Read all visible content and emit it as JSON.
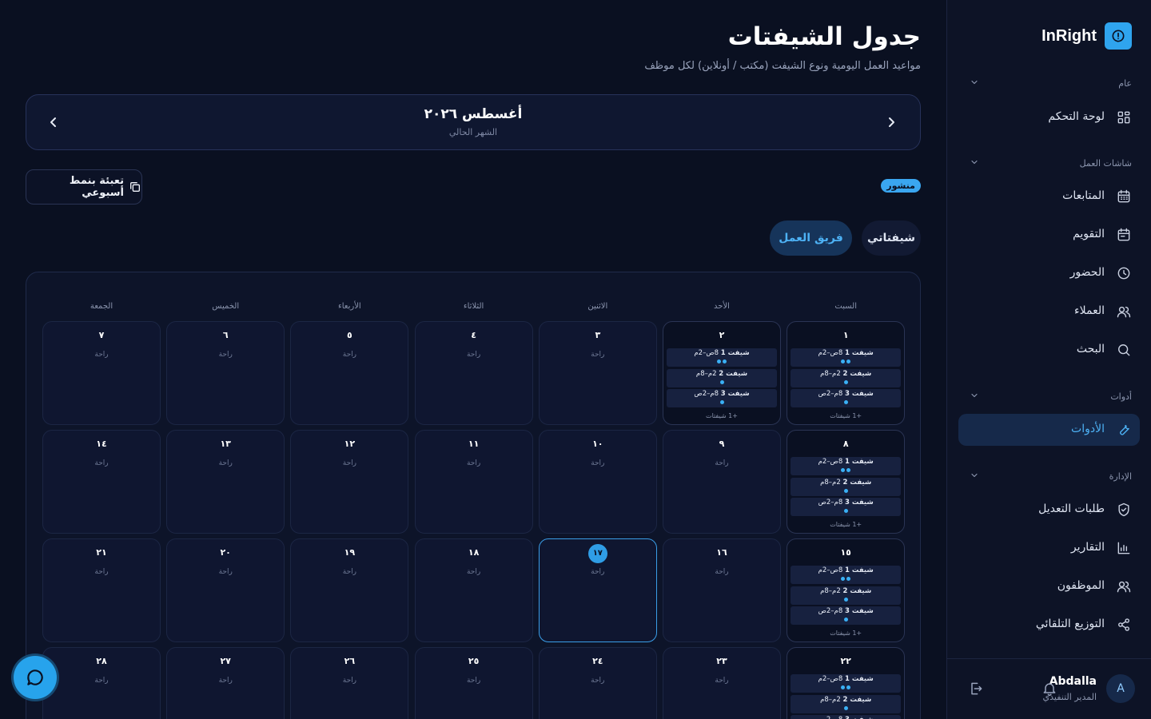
{
  "page": {
    "title": "جدول الشيفتات",
    "subtitle": "مواعيد العمل اليومية ونوع الشيفت (مكتب / أونلاين) لكل موظف"
  },
  "month_nav": {
    "month": "أغسطس ٢٠٢٦",
    "caption": "الشهر الحالي"
  },
  "toolbar": {
    "fill_weekly_label": "تعبئة بنمط أسبوعي",
    "status_badge": "منشور"
  },
  "view_tabs": {
    "my_shifts": "شيفتاتي",
    "team": "فريق العمل"
  },
  "calendar": {
    "weekdays": [
      "السبت",
      "الأحد",
      "الاثنين",
      "الثلاثاء",
      "الأربعاء",
      "الخميس",
      "الجمعة"
    ],
    "rest_label": "راحة",
    "shifts": [
      {
        "name": "شيفت 1",
        "time": "8ص–2م",
        "dots": 2
      },
      {
        "name": "شيفت 2",
        "time": "2م–8م",
        "dots": 1
      },
      {
        "name": "شيفت 3",
        "time": "8م–2ص",
        "dots": 1
      }
    ],
    "shift_count_label": "+1 شيفتات",
    "today": "١٧",
    "weeks": [
      [
        {
          "day": "١",
          "shifts": true
        },
        {
          "day": "٢",
          "shifts": true
        },
        {
          "day": "٣"
        },
        {
          "day": "٤"
        },
        {
          "day": "٥"
        },
        {
          "day": "٦"
        },
        {
          "day": "٧"
        }
      ],
      [
        {
          "day": "٨",
          "shifts": true
        },
        {
          "day": "٩"
        },
        {
          "day": "١٠"
        },
        {
          "day": "١١"
        },
        {
          "day": "١٢"
        },
        {
          "day": "١٣"
        },
        {
          "day": "١٤"
        }
      ],
      [
        {
          "day": "١٥",
          "shifts": true
        },
        {
          "day": "١٦"
        },
        {
          "day": "١٧"
        },
        {
          "day": "١٨"
        },
        {
          "day": "١٩"
        },
        {
          "day": "٢٠"
        },
        {
          "day": "٢١"
        }
      ],
      [
        {
          "day": "٢٢",
          "shifts": true
        },
        {
          "day": "٢٣"
        },
        {
          "day": "٢٤"
        },
        {
          "day": "٢٥"
        },
        {
          "day": "٢٦"
        },
        {
          "day": "٢٧"
        },
        {
          "day": "٢٨"
        }
      ]
    ]
  },
  "sidebar": {
    "brand": "InRight",
    "sections": [
      {
        "label": "عام",
        "items": [
          {
            "label": "لوحة التحكم",
            "icon": "dashboard-icon"
          }
        ]
      },
      {
        "label": "شاشات العمل",
        "items": [
          {
            "label": "المتابعات",
            "icon": "calendar-grid-icon"
          },
          {
            "label": "التقويم",
            "icon": "calendar-icon"
          },
          {
            "label": "الحضور",
            "icon": "clock-icon"
          },
          {
            "label": "العملاء",
            "icon": "users-icon"
          },
          {
            "label": "البحث",
            "icon": "search-icon"
          }
        ]
      },
      {
        "label": "أدوات",
        "items": [
          {
            "label": "الأدوات",
            "icon": "wrench-icon",
            "active": true
          }
        ]
      },
      {
        "label": "الإدارة",
        "items": [
          {
            "label": "طلبات التعديل",
            "icon": "shield-check-icon"
          },
          {
            "label": "التقارير",
            "icon": "bar-chart-icon"
          },
          {
            "label": "الموظفون",
            "icon": "users-icon"
          },
          {
            "label": "التوزيع التلقائي",
            "icon": "share-icon"
          }
        ]
      }
    ],
    "user": {
      "initial": "A",
      "name": "Abdalla",
      "role": "المدير التنفيذي"
    }
  },
  "colors": {
    "background": "#0a1021",
    "accent": "#2fa4ee",
    "active_tab_bg": "#16345a"
  }
}
